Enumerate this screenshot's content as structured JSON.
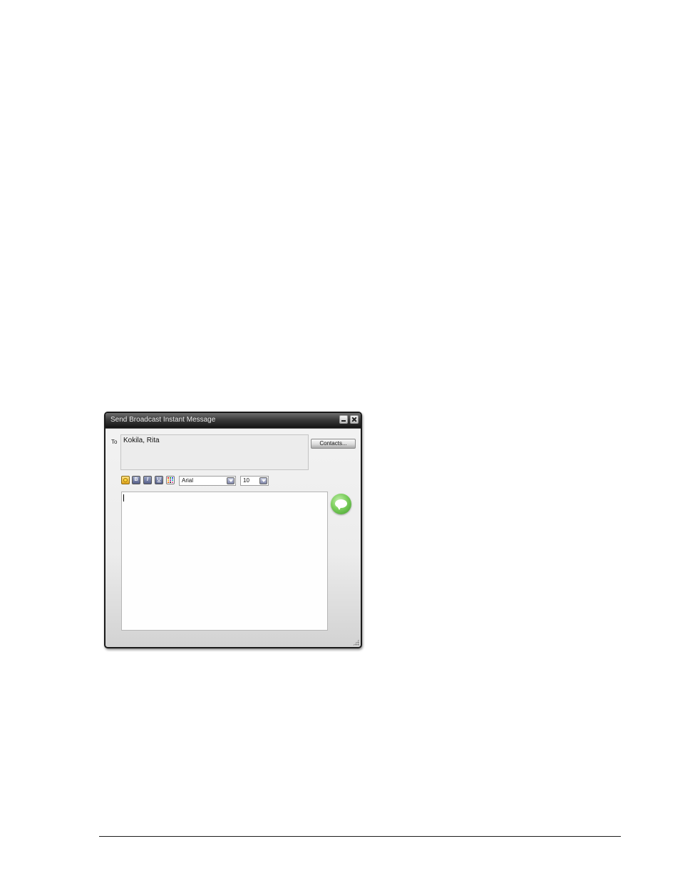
{
  "dialog": {
    "title": "Send Broadcast Instant Message",
    "to_label": "To",
    "recipients": "Kokila, Rita",
    "contacts_button": "Contacts...",
    "toolbar": {
      "bold_label": "B",
      "italic_label": "I",
      "underline_label": "U",
      "font_value": "Arial",
      "size_value": "10"
    },
    "message_text": "",
    "icons": {
      "emoticon": "emoticon-icon",
      "text_color": "text-color-icon",
      "send": "send-message-icon",
      "minimize": "minimize-icon",
      "close": "close-icon"
    },
    "palette": [
      "#e02020",
      "#20a020",
      "#2040e0",
      "#e0c020",
      "#a020c0",
      "#20c0c0",
      "#f07020",
      "#404040",
      "#e060a0"
    ]
  }
}
